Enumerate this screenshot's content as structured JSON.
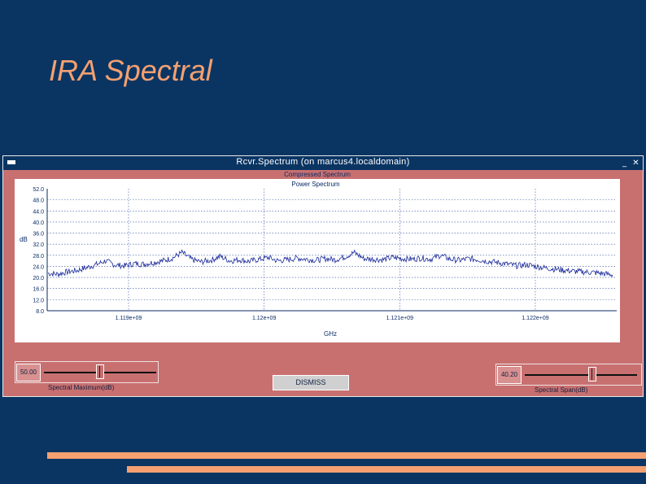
{
  "slide": {
    "title": "IRA Spectral"
  },
  "window": {
    "title": "Rcvr.Spectrum (on marcus4.localdomain)",
    "minimize_glyph": "_",
    "maximize_glyph": "▫",
    "close_glyph": "✕"
  },
  "plot": {
    "compressed_label": "Compressed Spectrum",
    "title": "Power Spectrum",
    "xlabel": "GHz",
    "ylabel": "dB"
  },
  "chart_data": {
    "type": "line",
    "title": "Power Spectrum",
    "xlabel": "GHz",
    "ylabel": "dB",
    "ylim": [
      8.0,
      52.0
    ],
    "ytick_labels": [
      "52.0",
      "48.0",
      "44.0",
      "40.0",
      "36.0",
      "32.0",
      "28.0",
      "24.0",
      "20.0",
      "16.0",
      "12.0",
      "8.0"
    ],
    "xtick_labels": [
      "1.119e+09",
      "1.12e+09",
      "1.121e+09",
      "1.122e+09"
    ],
    "grid": true,
    "series": [
      {
        "values": [
          21.5,
          21.2,
          22,
          22.5,
          23.5,
          24.6,
          26,
          24.5,
          24.2,
          25,
          24.8,
          25.4,
          26,
          27,
          29,
          26.5,
          25.6,
          26.2,
          27.6,
          26,
          26.4,
          25.8,
          26.5,
          27.2,
          26,
          26.4,
          27,
          26.6,
          26.2,
          26.8,
          26.4,
          27.4,
          29,
          26.8,
          26.6,
          26.4,
          27.2,
          26.8,
          26.6,
          27,
          26.6,
          28,
          26.6,
          26.2,
          26.8,
          26.4,
          25.8,
          25.4,
          24.8,
          24.2,
          24.6,
          24,
          23.4,
          23,
          22.6,
          22.2,
          22,
          21.8,
          21.4,
          21
        ]
      }
    ]
  },
  "controls": {
    "left_value": "50.00",
    "left_label": "Spectral Maximum(dB)",
    "left_level": 0.5,
    "dismiss_label": "DISMISS",
    "right_value": "40.20",
    "right_label": "Spectral Span(dB)",
    "right_level": 0.45
  }
}
